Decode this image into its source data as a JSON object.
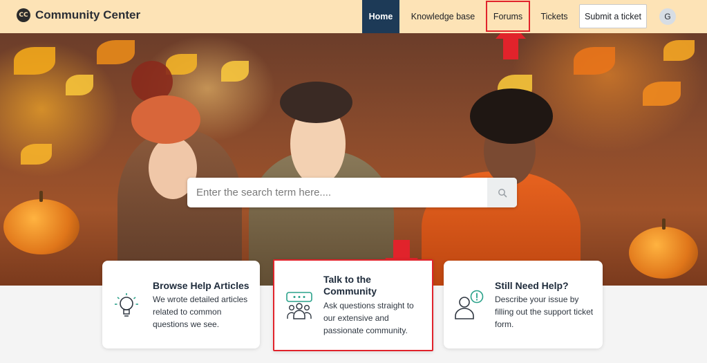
{
  "header": {
    "logo_text": "CC",
    "title": "Community Center",
    "nav": {
      "home": "Home",
      "knowledge_base": "Knowledge base",
      "forums": "Forums",
      "tickets": "Tickets",
      "submit_ticket": "Submit a ticket",
      "avatar_initial": "G"
    }
  },
  "search": {
    "placeholder": "Enter the search term here...."
  },
  "cards": [
    {
      "title": "Browse Help Articles",
      "description": "We wrote detailed articles related to common questions we see.",
      "icon": "lightbulb-icon"
    },
    {
      "title": "Talk to the Community",
      "description": "Ask questions straight to our extensive and passionate community.",
      "icon": "community-chat-icon"
    },
    {
      "title": "Still Need Help?",
      "description": "Describe your issue by filling out the support ticket form.",
      "icon": "person-alert-icon"
    }
  ],
  "colors": {
    "header_bg": "#fde3b6",
    "nav_active_bg": "#1d3a57",
    "highlight_red": "#e1232b",
    "icon_teal": "#2aa28a"
  }
}
